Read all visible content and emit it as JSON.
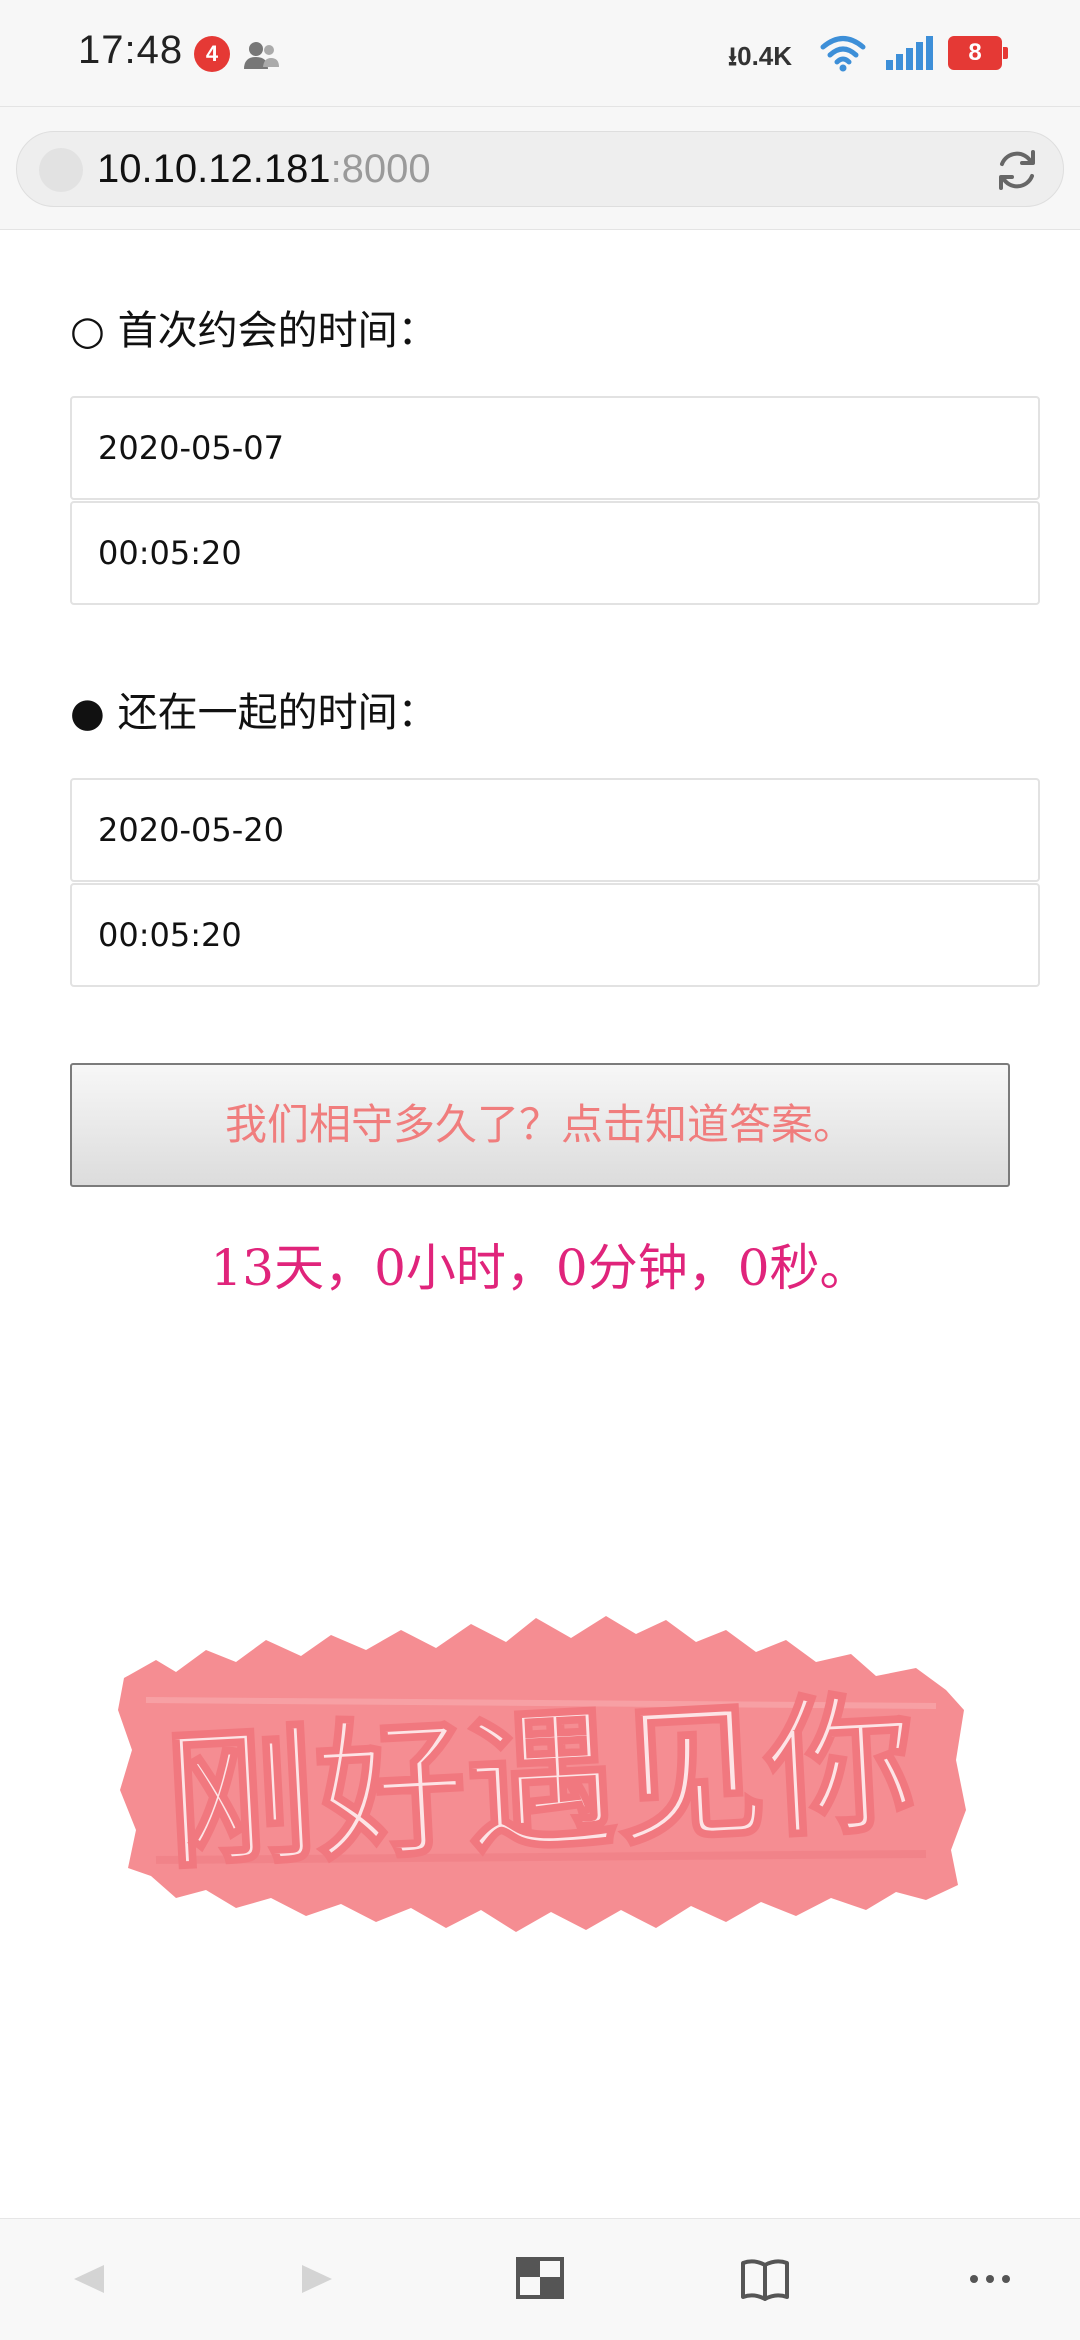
{
  "status_bar": {
    "time": "17:48",
    "notification_count": "4",
    "network_speed": "0.4K",
    "battery": "8"
  },
  "address_bar": {
    "host": "10.10.12.181",
    "port": ":8000"
  },
  "form": {
    "first_date_label": "○ 首次约会的时间：",
    "first_date": "2020-05-07",
    "first_time": "00:05:20",
    "together_label": "● 还在一起的时间：",
    "together_date": "2020-05-20",
    "together_time": "00:05:20"
  },
  "button_label": "我们相守多久了？点击知道答案。",
  "result": "13天，0小时，0分钟，0秒。",
  "banner_text": "刚好遇见你",
  "colors": {
    "accent_pink": "#e0247b",
    "button_text": "#f07d7d",
    "banner_bg": "#f58d92"
  }
}
